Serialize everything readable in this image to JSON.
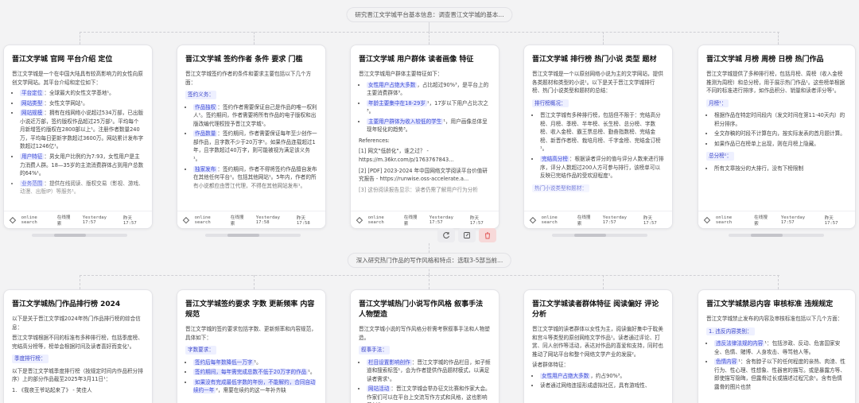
{
  "steps": {
    "top": "研究晋江文学城平台基本信息：调查晋江文学城的基本...",
    "middle": "深入研究热门作品的写作风格和特点：选取3-5部当前..."
  },
  "footer_common": {
    "tool": "online search",
    "tool_cn": "在线搜索"
  },
  "colors": {
    "accent": "#3b4bd6",
    "danger": "#e05555",
    "highlight_bg": "#e8eaff"
  },
  "action_icons": [
    "refresh-icon",
    "edit-icon",
    "delete-icon"
  ],
  "row1": [
    {
      "title": "晋江文学城 官网 平台介绍 定位",
      "intro": "晋江文学城是一个在中国大陆具有较高影响力的女性向原创文学网站。其平台介绍和定位如下：",
      "items": [
        {
          "key": "平台定位",
          "text": "：全球最大的女性文学基地¹。"
        },
        {
          "key": "网站类型",
          "text": "：女性文学网站¹。"
        },
        {
          "key": "网站规模",
          "text": "：拥有在线网络小说超过534万部，已出版小说近万部，签约版权作品超过25万部¹。平均每个月新增签约版权在2800部以上¹。注册作者数量240万，平均每日更新字数超过3600万。网站累计发布字数超过1246亿¹。"
        },
        {
          "key": "用户特征",
          "text": "：男女用户比例约为7:93，女性用户是主力消费人群。18—35岁的主流消费群体占到用户总数的64%¹。"
        },
        {
          "key": "业务范围",
          "text": "：提供在线阅读、版权交易（影视、游戏、动漫、出版IP）等服务¹。"
        }
      ],
      "time_left": "Yesterday 17:57",
      "time_right": "昨天 17:57"
    },
    {
      "title": "晋江文学城 签约作者 条件 要求 门槛",
      "intro": "晋江文学城签约作者的条件和要求主要包括以下几个方面：",
      "section": "签约义务：",
      "items": [
        {
          "key": "作品独权",
          "text": "：签约作者需要保证自己是作品的唯一权利人¹。签约期间，作者需要将所有作品的电子版权和出版改编代理权授予晋江文学城¹。"
        },
        {
          "key": "作品数量",
          "text": "：签约期间，作者需要保证每年至少创作一部作品，且字数不少于20万字¹。如果作品连载超过1年，且字数超过40万字，则可能被视为满足该义务¹。"
        },
        {
          "key": "独家发布",
          "text": "：签约期间，作者不得将签约作品擅自发布在其他任何平台¹。包括其他网站¹。5年内，作者的所有小说都应由晋江代理，不得在其他网站发布¹。"
        }
      ],
      "time_left": "Yesterday 17:58",
      "time_right": "昨天 17:58"
    },
    {
      "title": "晋江文学城 用户群体 读者画像 特征",
      "intro": "晋江文学城用户群体主要特征如下：",
      "items": [
        {
          "key": "女性用户占绝大多数",
          "text": "，占比超过90%³，是平台上的主要消费群体³。"
        },
        {
          "key": "年龄主要集中在18-29岁",
          "text": "¹，17岁以下用户占比次之³。"
        },
        {
          "key": "主要用户群体为收入较低的学生",
          "text": "¹，用户画像总体呈现年轻化的趋势³。"
        }
      ],
      "refs_title": "References:",
      "refs": [
        "[1] 网文\"低龄化\"，谁之过？ - https://m.36kr.com/p/1763767843...",
        "[2] [PDF] 2023-2024 年中国网络文学阅读平台价值研究报告 - https://runwise.oss-accelerate.a...",
        "[3] 这份阅读报告显示：读者仍需了解用户行为分析"
      ],
      "time_left": "Yesterday 17:57",
      "time_right": "昨天 17:57"
    },
    {
      "title": "晋江文学城 排行榜 热门小说 类型 题材",
      "intro": "晋江文学城是一个以原创网络小说为主的文学网站，提供各类题材和类型的小说¹。以下是关于晋江文学城排行榜、热门小说类型和题材的总结：",
      "section": "排行榜概况：",
      "items": [
        {
          "key": "",
          "text": "晋江文学城有多种排行榜，包括但不限于：完结高分榜、月榜、季榜、半年榜、长生榜、总分榜、字数榜、收入金榜、霸王票总榜、勤奋指数榜、完结金榜、新晋作者榜、栽培月榜、千字金榜、完结金订榜¹。"
        },
        {
          "key": "完结高分榜",
          "text": "：根据读者评分的值与评分人数来进行排序，评分人数超过200人方可参与排行，该榜单可以反映已完结作品的受欢迎程度¹。"
        }
      ],
      "section2": "热门小说类型和题材：",
      "time_left": "Yesterday 17:57",
      "time_right": "昨天 17:57"
    },
    {
      "title": "晋江文学城 月榜 周榜 日榜 热门作品",
      "intro": "晋江文学城提供了多种排行榜，包括月榜、周榜（收入金榜推测为周榜）和总分榜，用于展示热门作品¹。这些榜单根据不同的标准进行排序，如作品积分、销量和读者评分等¹。",
      "section": "月榜¹：",
      "items": [
        {
          "key": "",
          "text": "根据作品在特定时间段内（发文时间在第11-40天内）的积分排序。"
        },
        {
          "key": "",
          "text": "全文存稿的时段不计算在内，按实际发表的首月题计算。"
        },
        {
          "key": "",
          "text": "如果作品已在榜单上出现，则在月榜上隐藏。"
        }
      ],
      "section2": "总分榜¹：",
      "tail": "所有文章按分的大排行，没有下榜限制",
      "time_left": "Yesterday 17:57",
      "time_right": "昨天 17:57"
    }
  ],
  "row2": [
    {
      "title": "晋江文学城热门作品排行榜 2024",
      "intro": "以下是关于晋江文学城2024年热门作品排行榜的综合信息：",
      "p2": "晋江文学城根据不同的标准有多种排行榜，包括季度榜、完结高分榜等，榜单会根据时间及读者喜好而变化¹。",
      "section": "季度排行榜：",
      "p3": "以下是晋江文学城季度排行榜（按规定时间内作品积分排序）上的部分作品截至2025年3月11日¹：",
      "li": "1. 《我夜王爷站起来了》 - 笑佳人"
    },
    {
      "title": "晋江文学城签约要求 字数 更新频率 内容规范",
      "intro": "晋江文学城的签约要求包括字数、更新频率和内容规范，具体如下：",
      "section": "字数要求：",
      "items": [
        {
          "key": "签约后每年数降低一万字",
          "text": "¹。"
        },
        {
          "key": "签约期间，每年需完成总数不低于20万字的作品",
          "text": "¹。"
        },
        {
          "key": "如果没有完成最低字数的年份，不能解约，合同自动续约一年",
          "text": "²，需要在续约的这一年补齐缺"
        }
      ]
    },
    {
      "title": "晋江文学城热门小说写作风格 叙事手法 人物塑造",
      "intro": "晋江文学城小说的写作风格分析需考察叙事手法和人物塑造。",
      "section": "叙事手法：",
      "items": [
        {
          "key": "栏目设置影响创作",
          "text": "：晋江文学城的作品栏目，如子频道和搜索标签¹，会为作者提供作品题材模式，以满足读者需求¹。"
        },
        {
          "key": "网站活动",
          "text": "：晋江文学城会举办征文比赛和作家大会。作家们可以在平台上交流写作方式和风格，这也影响着创作"
        }
      ]
    },
    {
      "title": "晋江文学城读者群体特征 阅读偏好 评论分析",
      "intro": "晋江文学城的读者群体以女性为主，阅读偏好集中于耽美和宫斗等类型的原创网络文学作品¹。读者通过评论、打赏、同人创作等活动，表达对作品的喜爱和支持，同时也推动了网站平台和整个网络文学产业的发展²。",
      "section": "读者群体特征：",
      "items": [
        {
          "key": "女性用户占绝大多数",
          "text": "，约占90%³。"
        },
        {
          "key": "",
          "text": "读者通过网络连接形成虚拟社区，具有游戏性、"
        }
      ]
    },
    {
      "title": "晋江文学城禁忌内容 审核标准 违规规定",
      "intro": "晋江文学城禁止发布的内容及审核标准包括以下几个方面：",
      "section": "1. 违反内容类别：",
      "items": [
        {
          "key": "违反法律法规的内容",
          "text": "¹：包括涉政、反动、危害国家安全、色情、赌博、人身攻击、辱骂他人等。"
        },
        {
          "key": "色情内容",
          "text": "¹：含有脖子以下的任何程度的亲热、肉渣、性行为、性心理、性想象、性器官的描写。或是暴露方等、即使描写隐晦，但露骨过长或描述过程冗余¹。含有色情露骨的图片也禁"
        }
      ]
    }
  ]
}
